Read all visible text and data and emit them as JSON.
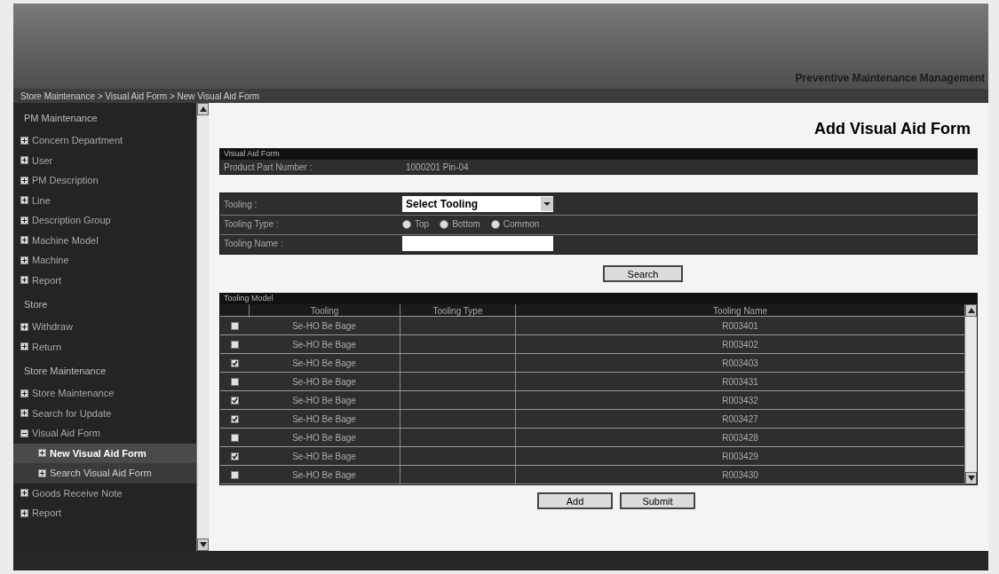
{
  "header": {
    "title": "Preventive Maintenance Management"
  },
  "breadcrumb": "Store Maintenance > Visual Aid Form > New Visual Aid Form",
  "sidebar": {
    "items": [
      {
        "kind": "header",
        "label": "PM Maintenance"
      },
      {
        "kind": "item",
        "label": "Concern Department",
        "expanded": false,
        "selected": false
      },
      {
        "kind": "item",
        "label": "User",
        "expanded": false,
        "selected": false
      },
      {
        "kind": "item",
        "label": "PM Description",
        "expanded": false,
        "selected": false
      },
      {
        "kind": "item",
        "label": "Line",
        "expanded": false,
        "selected": false
      },
      {
        "kind": "item",
        "label": "Description Group",
        "expanded": false,
        "selected": false
      },
      {
        "kind": "item",
        "label": "Machine Model",
        "expanded": false,
        "selected": false
      },
      {
        "kind": "item",
        "label": "Machine",
        "expanded": false,
        "selected": false
      },
      {
        "kind": "item",
        "label": "Report",
        "expanded": false,
        "selected": false
      },
      {
        "kind": "header",
        "label": "Store"
      },
      {
        "kind": "item",
        "label": "Withdraw",
        "expanded": false,
        "selected": false
      },
      {
        "kind": "item",
        "label": "Return",
        "expanded": false,
        "selected": false
      },
      {
        "kind": "header",
        "label": "Store Maintenance"
      },
      {
        "kind": "item",
        "label": "Store Maintenance",
        "expanded": false,
        "selected": false
      },
      {
        "kind": "item",
        "label": "Search for Update",
        "expanded": false,
        "selected": false
      },
      {
        "kind": "item",
        "label": "Visual Aid Form",
        "expanded": true,
        "selected": false,
        "children": [
          {
            "kind": "item",
            "label": "New Visual Aid Form",
            "expanded": false,
            "selected": true
          },
          {
            "kind": "item",
            "label": "Search Visual Aid Form",
            "expanded": false,
            "selected": false
          }
        ]
      },
      {
        "kind": "item",
        "label": "Goods Receive Note",
        "expanded": false,
        "selected": false
      },
      {
        "kind": "item",
        "label": "Report",
        "expanded": false,
        "selected": false
      }
    ]
  },
  "page_title": "Add Visual Aid Form",
  "form": {
    "section_title": "Visual Aid Form",
    "part_number": {
      "label": "Product Part Number :",
      "value": "1000201 Pin-04"
    },
    "tooling": {
      "label": "Tooling :",
      "value": "Select Tooling"
    },
    "tooling_type": {
      "label": "Tooling Type :",
      "options": [
        {
          "label": "Top",
          "selected": false
        },
        {
          "label": "Bottom",
          "selected": false
        },
        {
          "label": "Common",
          "selected": false
        }
      ]
    },
    "tooling_name": {
      "label": "Tooling Name :"
    }
  },
  "search_button": "Search",
  "table": {
    "title": "Tooling Model",
    "columns": [
      "Tooling",
      "Tooling Type",
      "Tooling Name"
    ],
    "rows": [
      {
        "checked": false,
        "tooling": "Se-HO Be Bage",
        "tooling_name": "R003401"
      },
      {
        "checked": false,
        "tooling": "Se-HO Be Bage",
        "tooling_name": "R003402"
      },
      {
        "checked": true,
        "tooling": "Se-HO Be Bage",
        "tooling_name": "R003403"
      },
      {
        "checked": false,
        "tooling": "Se-HO Be Bage",
        "tooling_name": "R003431"
      },
      {
        "checked": true,
        "tooling": "Se-HO Be Bage",
        "tooling_name": "R003432"
      },
      {
        "checked": true,
        "tooling": "Se-HO Be Bage",
        "tooling_name": "R003427"
      },
      {
        "checked": false,
        "tooling": "Se-HO Be Bage",
        "tooling_name": "R003428"
      },
      {
        "checked": true,
        "tooling": "Se-HO Be Bage",
        "tooling_name": "R003429"
      },
      {
        "checked": false,
        "tooling": "Se-HO Be Bage",
        "tooling_name": "R003430"
      }
    ]
  },
  "buttons": [
    "Add",
    "Submit"
  ]
}
